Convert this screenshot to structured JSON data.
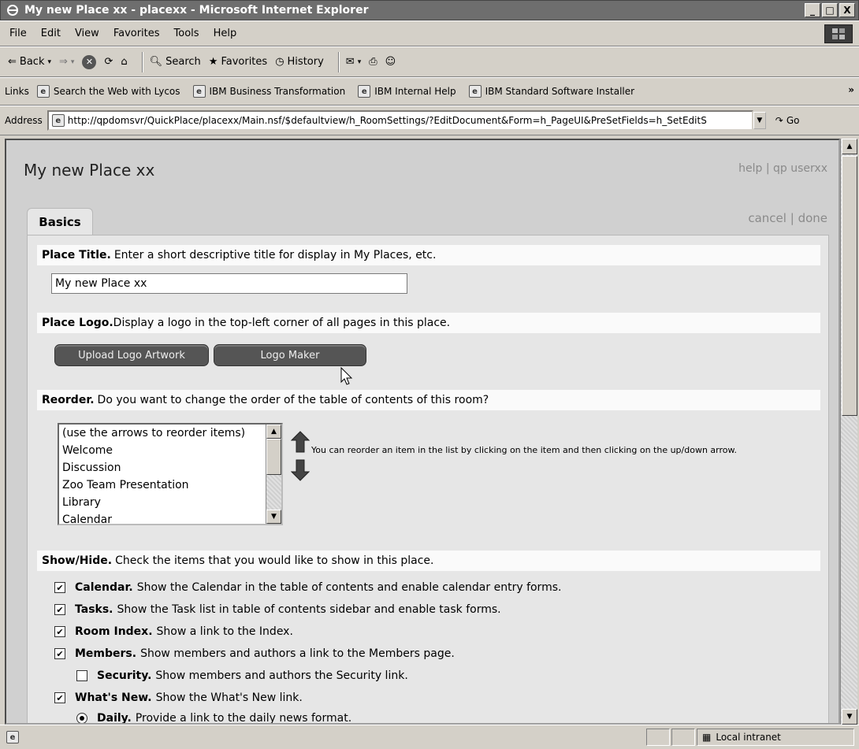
{
  "window": {
    "title": "My new Place xx - placexx - Microsoft Internet Explorer",
    "min": "_",
    "max": "□",
    "close": "X"
  },
  "menu": [
    "File",
    "Edit",
    "View",
    "Favorites",
    "Tools",
    "Help"
  ],
  "toolbar": {
    "back": "Back",
    "search": "Search",
    "favorites": "Favorites",
    "history": "History"
  },
  "links": {
    "label": "Links",
    "items": [
      "Search the Web with Lycos",
      "IBM Business Transformation",
      "IBM Internal Help",
      "IBM Standard Software Installer"
    ],
    "more": "»"
  },
  "address": {
    "label": "Address",
    "url": "http://qpdomsvr/QuickPlace/placexx/Main.nsf/$defaultview/h_RoomSettings/?EditDocument&Form=h_PageUI&PreSetFields=h_SetEditS",
    "go": "Go"
  },
  "page": {
    "title": "My new Place xx",
    "help": "help",
    "user": "qp userxx",
    "separator": "|",
    "tab": "Basics",
    "cancel": "cancel",
    "done": "done"
  },
  "sections": {
    "title": {
      "heading": "Place Title.",
      "desc": "Enter a short descriptive title for display in My Places, etc.",
      "value": "My new Place xx"
    },
    "logo": {
      "heading": "Place Logo.",
      "desc": "Display a logo in the top-left corner of all pages in this place.",
      "upload": "Upload Logo Artwork",
      "maker": "Logo Maker"
    },
    "reorder": {
      "heading": "Reorder.",
      "desc": "Do you want to change the order of the table of contents of this room?",
      "items": [
        "(use the arrows to reorder items)",
        "Welcome",
        "Discussion",
        "Zoo Team Presentation",
        "Library",
        "Calendar"
      ],
      "help": "You can reorder an item in the list by clicking on the item and then clicking on the up/down arrow."
    },
    "showhide": {
      "heading": "Show/Hide.",
      "desc": "Check the items that you would like to show in this place.",
      "items": [
        {
          "label": "Calendar.",
          "desc": "Show the Calendar in the table of contents and enable calendar entry forms.",
          "checked": true
        },
        {
          "label": "Tasks.",
          "desc": "Show the Task list in table of contents sidebar and enable task forms.",
          "checked": true
        },
        {
          "label": "Room Index.",
          "desc": "Show a link to the Index.",
          "checked": true
        },
        {
          "label": "Members.",
          "desc": "Show members and authors a link to the Members page.",
          "checked": true
        },
        {
          "label": "Security.",
          "desc": "Show members and authors the Security link.",
          "checked": false
        },
        {
          "label": "What's New.",
          "desc": "Show the What's New link.",
          "checked": true
        },
        {
          "label": "Daily.",
          "desc": "Provide a link to the daily news format.",
          "checked": true
        }
      ]
    }
  },
  "status": {
    "zone": "Local intranet"
  }
}
